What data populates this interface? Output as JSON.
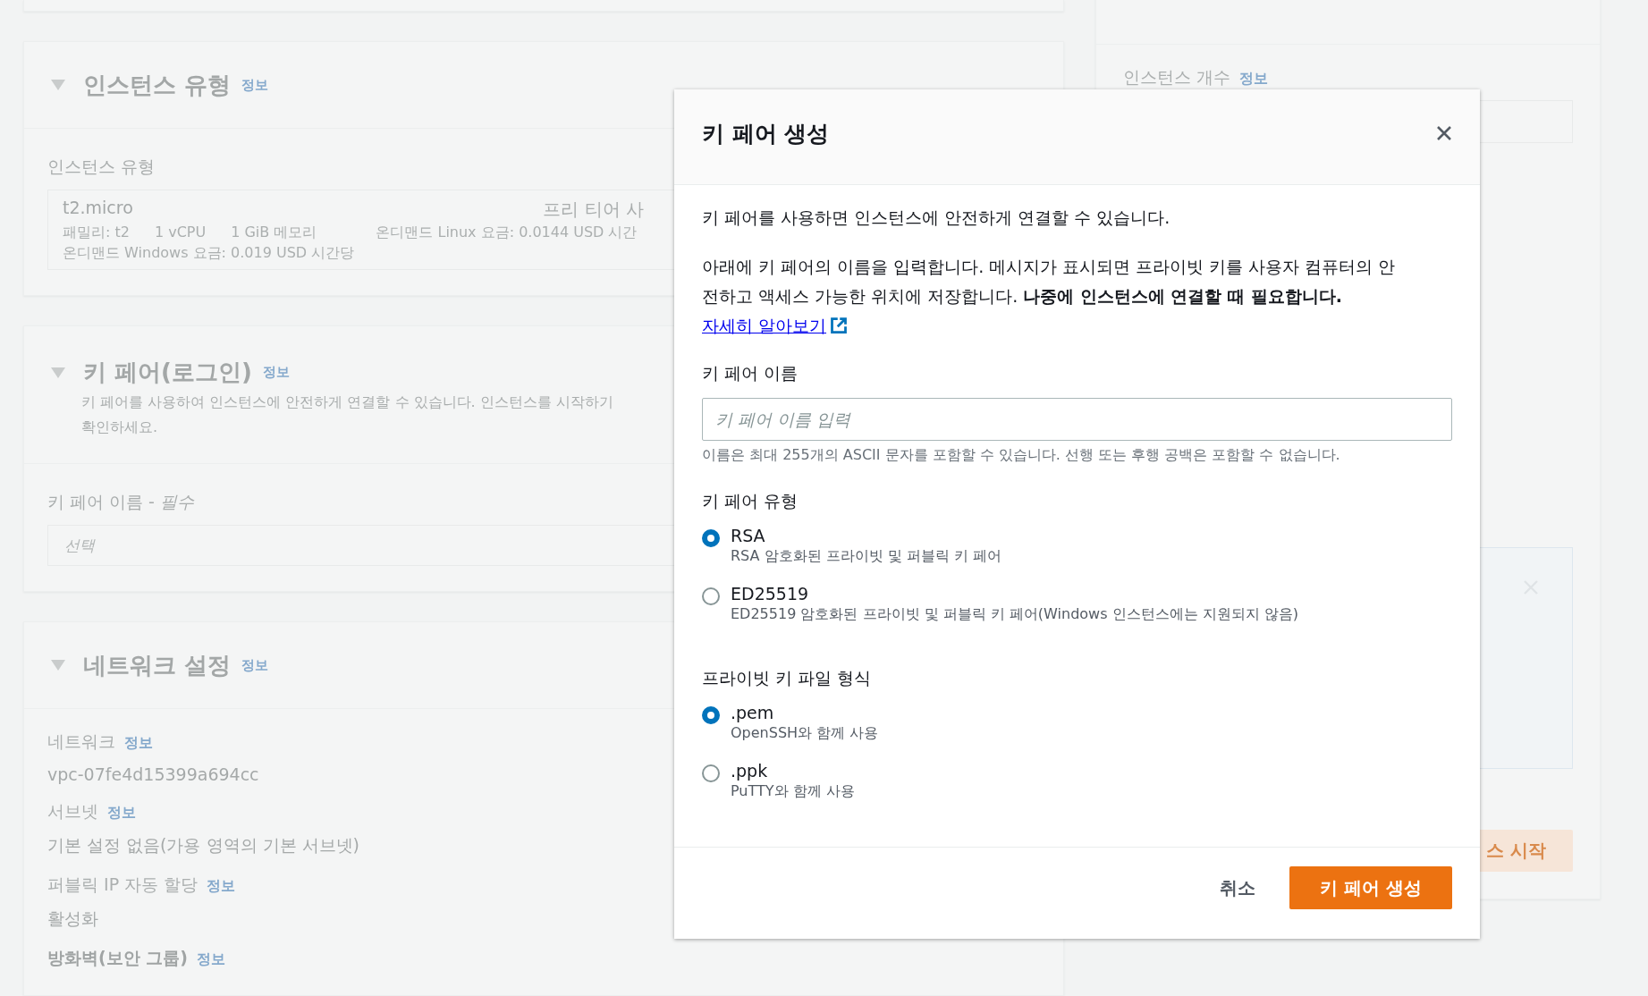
{
  "page": {
    "instance_type_section": {
      "title": "인스턴스 유형",
      "info_link": "정보",
      "field_label": "인스턴스 유형",
      "instance": {
        "name": "t2.micro",
        "badge": "프리 티어 사",
        "specs": [
          "패밀리: t2",
          "1 vCPU",
          "1 GiB 메모리",
          "온디맨드 Linux 요금: 0.0144 USD 시간"
        ],
        "windows_price": "온디맨드 Windows 요금: 0.019 USD 시간당"
      }
    },
    "key_pair_section": {
      "title": "키 페어(로그인)",
      "info_link": "정보",
      "description": [
        "키 페어를 사용하여 인스턴스에 안전하게 연결할 수 있습니다. 인스턴스를 시작하기",
        "확인하세요."
      ],
      "field_label": "키 페어 이름 - *필수*",
      "select_placeholder": "선택"
    },
    "network_section": {
      "title": "네트워크 설정",
      "info_link": "정보",
      "fields": [
        {
          "kind": "plain",
          "label": "네트워크",
          "info_link": "정보",
          "value": "vpc-07fe4d15399a694cc"
        },
        {
          "kind": "plain",
          "label": "서브넷",
          "info_link": "정보",
          "value": "기본 설정 없음(가용 영역의 기본 서브넷)"
        },
        {
          "kind": "plain",
          "label": "퍼블릭 IP 자동 할당",
          "info_link": "정보",
          "value": "활성화"
        },
        {
          "kind": "heading",
          "label": "방화벽(보안 그룹)",
          "info_link": "정보"
        }
      ]
    },
    "summary": {
      "field_label": "인스턴스 개수",
      "info_link": "정보",
      "launch_button": "스 시작"
    }
  },
  "modal": {
    "title": "키 페어 생성",
    "intro": "키 페어를 사용하면 인스턴스에 안전하게 연결할 수 있습니다.",
    "paragraph": "아래에 키 페어의 이름을 입력합니다. 메시지가 표시되면 프라이빗 키를 사용자 컴퓨터의 안전하고 액세스 가능한 위치에 저장합니다. **나중에 인스턴스에 연결할 때 필요합니다.**",
    "link": "자세히 알아보기",
    "name_field": {
      "label": "키 페어 이름",
      "placeholder": "키 페어 이름 입력",
      "hint": "이름은 최대 255개의 ASCII 문자를 포함할 수 있습니다. 선행 또는 후행 공백은 포함할 수 없습니다."
    },
    "key_pair_type": {
      "label": "키 페어 유형",
      "options": [
        {
          "label": "RSA",
          "description": "RSA 암호화된 프라이빗 및 퍼블릭 키 페어",
          "selected": true
        },
        {
          "label": "ED25519",
          "description": "ED25519 암호화된 프라이빗 및 퍼블릭 키 페어(Windows 인스턴스에는 지원되지 않음)",
          "selected": false
        }
      ]
    },
    "file_format": {
      "label": "프라이빗 키 파일 형식",
      "options": [
        {
          "label": ".pem",
          "description": "OpenSSH와 함께 사용",
          "selected": true
        },
        {
          "label": ".ppk",
          "description": "PuTTY와 함께 사용",
          "selected": false
        }
      ]
    },
    "buttons": {
      "cancel": "취소",
      "create": "키 페어 생성"
    }
  }
}
